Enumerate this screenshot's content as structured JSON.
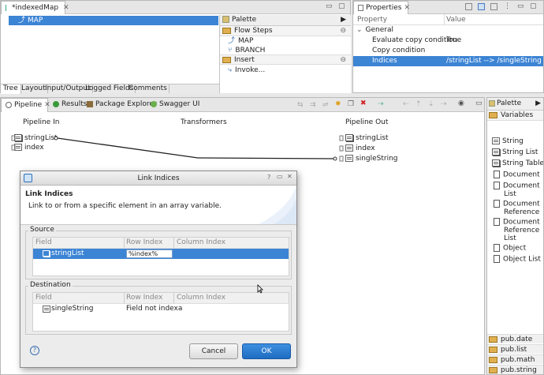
{
  "editor": {
    "tab_title": "*indexedMap",
    "tree_item": "MAP",
    "bottom_tabs": [
      "Tree",
      "Layout",
      "Input/Output",
      "Logged Fields",
      "Comments"
    ]
  },
  "palette_top": {
    "title": "Palette",
    "flow_steps": "Flow Steps",
    "map_item": "MAP",
    "branch_item": "BRANCH",
    "insert": "Insert",
    "invoke_item": "Invoke..."
  },
  "properties": {
    "tab_title": "Properties",
    "col_property": "Property",
    "col_value": "Value",
    "group": "General",
    "rows": [
      {
        "name": "Evaluate copy condition",
        "value": "True"
      },
      {
        "name": "Copy condition",
        "value": ""
      },
      {
        "name": "Indices",
        "value": "/stringList --> /singleString"
      }
    ]
  },
  "bottom_tabs": {
    "pipeline": "Pipeline",
    "results": "Results",
    "package_explorer": "Package Explorer",
    "swagger": "Swagger UI"
  },
  "pipeline": {
    "in_header": "Pipeline In",
    "transformers_header": "Transformers",
    "out_header": "Pipeline Out",
    "in_vars": [
      "stringList",
      "index"
    ],
    "out_vars": [
      "stringList",
      "index",
      "singleString"
    ]
  },
  "palette_right": {
    "title": "Palette",
    "variables": "Variables",
    "items": [
      "String",
      "String List",
      "String Table",
      "Document",
      "Document List",
      "Document Reference",
      "Document Reference List",
      "Object",
      "Object List"
    ],
    "packages": [
      "pub.date",
      "pub.list",
      "pub.math",
      "pub.string"
    ]
  },
  "dialog": {
    "title": "Link Indices",
    "heading": "Link Indices",
    "description": "Link to or from a specific element in an array variable.",
    "source_label": "Source",
    "destination_label": "Destination",
    "col_field": "Field",
    "col_row_index": "Row Index",
    "col_column_index": "Column Index",
    "source_row": {
      "field": "stringList",
      "row_index": "%index%"
    },
    "dest_row": {
      "field": "singleString",
      "row_index": "Field not indexa"
    },
    "cancel": "Cancel",
    "ok": "OK"
  }
}
